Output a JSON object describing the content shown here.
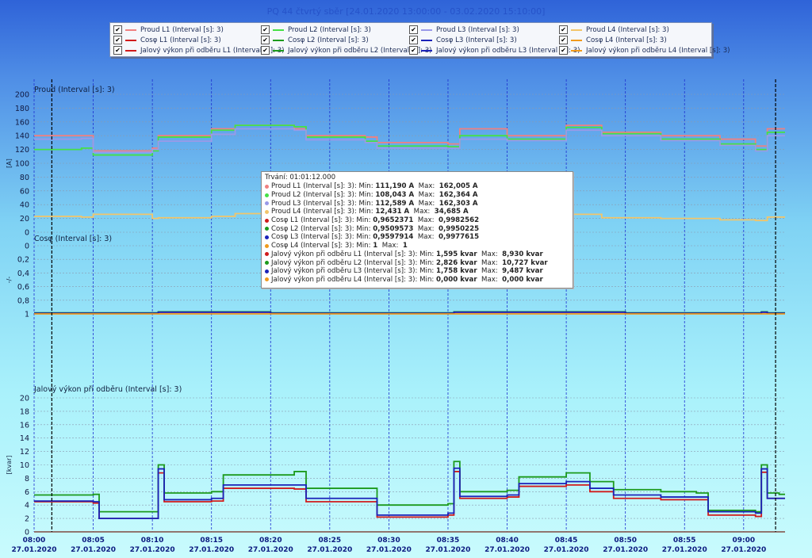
{
  "window_title": "PQ 44 čtvrtý sběr [24.01.2020 13:00:00 - 03.02.2020 15:10:00]",
  "legend": [
    {
      "label": "Proud L1 (Interval [s]: 3)",
      "color": "#f08080",
      "checked": "✔"
    },
    {
      "label": "Proud L2 (Interval [s]: 3)",
      "color": "#46e046",
      "checked": "✔"
    },
    {
      "label": "Proud L3 (Interval [s]: 3)",
      "color": "#9a9ae8",
      "checked": "✔"
    },
    {
      "label": "Proud L4 (Interval [s]: 3)",
      "color": "#f2c56a",
      "checked": "✔"
    },
    {
      "label": "Cosφ L1 (Interval [s]: 3)",
      "color": "#d11b1b",
      "checked": "✔"
    },
    {
      "label": "Cosφ L2 (Interval [s]: 3)",
      "color": "#1c9a1c",
      "checked": "✔"
    },
    {
      "label": "Cosφ L3 (Interval [s]: 3)",
      "color": "#1b22b8",
      "checked": "✔"
    },
    {
      "label": "Cosφ L4 (Interval [s]: 3)",
      "color": "#f09a1c",
      "checked": "✔"
    },
    {
      "label": "Jalový výkon při odběru L1 (Interval [s]: 3)",
      "color": "#d11b1b",
      "checked": "✔"
    },
    {
      "label": "Jalový výkon při odběru L2 (Interval [s]: 3)",
      "color": "#1c9a1c",
      "checked": "✔"
    },
    {
      "label": "Jalový výkon při odběru L3 (Interval [s]: 3)",
      "color": "#1b22b8",
      "checked": "✔"
    },
    {
      "label": "Jalový výkon při odběru L4 (Interval [s]: 3)",
      "color": "#f09a1c",
      "checked": "✔"
    }
  ],
  "tooltip": {
    "duration": "Trvání: 01:01:12.000",
    "rows": [
      {
        "name": "Proud L1 (Interval [s]: 3): Min:",
        "min": "111,190 A",
        "max_label": "Max:",
        "max": "162,005 A",
        "color": "#f08080"
      },
      {
        "name": "Proud L2 (Interval [s]: 3): Min:",
        "min": "108,043 A",
        "max_label": "Max:",
        "max": "162,364 A",
        "color": "#46e046"
      },
      {
        "name": "Proud L3 (Interval [s]: 3): Min:",
        "min": "112,589 A",
        "max_label": "Max:",
        "max": "162,303 A",
        "color": "#9a9ae8"
      },
      {
        "name": "Proud L4 (Interval [s]: 3): Min:",
        "min": "12,431 A",
        "max_label": "Max:",
        "max": "34,685 A",
        "color": "#f2c56a"
      },
      {
        "name": "Cosφ L1 (Interval [s]: 3): Min:",
        "min": "0,9652371",
        "max_label": "Max:",
        "max": "0,9982562",
        "color": "#d11b1b"
      },
      {
        "name": "Cosφ L2 (Interval [s]: 3): Min:",
        "min": "0,9509573",
        "max_label": "Max:",
        "max": "0,9950225",
        "color": "#1c9a1c"
      },
      {
        "name": "Cosφ L3 (Interval [s]: 3): Min:",
        "min": "0,9597914",
        "max_label": "Max:",
        "max": "0,9977615",
        "color": "#1b22b8"
      },
      {
        "name": "Cosφ L4 (Interval [s]: 3): Min:",
        "min": "1",
        "max_label": "Max:",
        "max": "1",
        "color": "#f09a1c"
      },
      {
        "name": "Jalový výkon při odběru L1 (Interval [s]: 3): Min:",
        "min": "1,595 kvar",
        "max_label": "Max:",
        "max": "8,930 kvar",
        "color": "#d11b1b"
      },
      {
        "name": "Jalový výkon při odběru L2 (Interval [s]: 3): Min:",
        "min": "2,826 kvar",
        "max_label": "Max:",
        "max": "10,727 kvar",
        "color": "#1c9a1c"
      },
      {
        "name": "Jalový výkon při odběru L3 (Interval [s]: 3): Min:",
        "min": "1,758 kvar",
        "max_label": "Max:",
        "max": "9,487 kvar",
        "color": "#1b22b8"
      },
      {
        "name": "Jalový výkon při odběru L4 (Interval [s]: 3): Min:",
        "min": "0,000 kvar",
        "max_label": "Max:",
        "max": "0,000 kvar",
        "color": "#f09a1c"
      }
    ]
  },
  "chart_data": [
    {
      "type": "line",
      "title": "Proud (Interval [s]: 3)",
      "ylabel": "[A]",
      "ylim": [
        0,
        200
      ],
      "yticks": [
        0,
        20,
        40,
        60,
        80,
        100,
        120,
        140,
        160,
        180,
        200
      ],
      "ytick_labels": [
        "0",
        "20",
        "40",
        "60",
        "80",
        "100",
        "120",
        "140",
        "160",
        "180",
        "200"
      ],
      "grid": true,
      "x_minutes": [
        0,
        4,
        5,
        10,
        10.5,
        15,
        17,
        22,
        23,
        28,
        29,
        35,
        36,
        40,
        45,
        48,
        53,
        58,
        61,
        62
      ],
      "series": [
        {
          "name": "Proud L1",
          "color": "#f08080",
          "values": [
            140,
            140,
            118,
            122,
            140,
            150,
            155,
            150,
            140,
            138,
            130,
            128,
            150,
            140,
            155,
            145,
            140,
            135,
            125,
            150
          ]
        },
        {
          "name": "Proud L2",
          "color": "#46e046",
          "values": [
            120,
            122,
            112,
            118,
            138,
            148,
            155,
            153,
            138,
            132,
            125,
            124,
            140,
            135,
            152,
            143,
            135,
            128,
            120,
            145
          ]
        },
        {
          "name": "Proud L3",
          "color": "#9a9ae8",
          "values": [
            135,
            136,
            116,
            120,
            132,
            142,
            150,
            148,
            134,
            130,
            122,
            122,
            135,
            133,
            148,
            140,
            133,
            126,
            118,
            140
          ]
        },
        {
          "name": "Proud L4",
          "color": "#f2c56a",
          "values": [
            23,
            22,
            26,
            20,
            21,
            23,
            27,
            25,
            22,
            24,
            23,
            20,
            25,
            23,
            26,
            21,
            20,
            18,
            17,
            22
          ]
        }
      ]
    },
    {
      "type": "line",
      "title": "Cosφ (Interval [s]: 3)",
      "ylabel": "-/-",
      "ylim": [
        0,
        1
      ],
      "yticks": [
        0,
        0.2,
        0.4,
        0.6,
        0.8,
        1
      ],
      "ytick_labels": [
        "0",
        "0,2",
        "0,4",
        "0,6",
        "0,8",
        "1"
      ],
      "y_inverted": true,
      "grid": true,
      "x_minutes": [
        0,
        10,
        10.5,
        20,
        35,
        35.5,
        50,
        61.5,
        62
      ],
      "series": [
        {
          "name": "Cosφ L1",
          "color": "#d11b1b",
          "values": [
            0.99,
            0.99,
            0.975,
            0.99,
            0.99,
            0.975,
            0.99,
            0.975,
            0.99
          ]
        },
        {
          "name": "Cosφ L2",
          "color": "#1c9a1c",
          "values": [
            0.985,
            0.985,
            0.97,
            0.985,
            0.985,
            0.97,
            0.985,
            0.97,
            0.985
          ]
        },
        {
          "name": "Cosφ L3",
          "color": "#1b22b8",
          "values": [
            0.99,
            0.99,
            0.975,
            0.99,
            0.99,
            0.975,
            0.99,
            0.975,
            0.99
          ]
        },
        {
          "name": "Cosφ L4",
          "color": "#f09a1c",
          "values": [
            1,
            1,
            1,
            1,
            1,
            1,
            1,
            1,
            1
          ]
        }
      ]
    },
    {
      "type": "line",
      "title": "Jalový výkon při odběru (Interval [s]: 3)",
      "ylabel": "[kvar]",
      "ylim": [
        0,
        20
      ],
      "yticks": [
        0,
        2,
        4,
        6,
        8,
        10,
        12,
        14,
        16,
        18,
        20
      ],
      "ytick_labels": [
        "0",
        "2",
        "4",
        "6",
        "8",
        "10",
        "12",
        "14",
        "16",
        "18",
        "20"
      ],
      "grid": true,
      "x_minutes": [
        0,
        5,
        5.5,
        10,
        10.5,
        11,
        15,
        16,
        22,
        23,
        28,
        29,
        35,
        35.5,
        36,
        40,
        41,
        45,
        47,
        49,
        53,
        56,
        57,
        61,
        61.5,
        62,
        63
      ],
      "series": [
        {
          "name": "Jalový výkon L1",
          "color": "#d11b1b",
          "values": [
            4.5,
            4.3,
            2.0,
            2.0,
            8.8,
            4.5,
            4.6,
            6.5,
            6.4,
            4.5,
            4.5,
            2.2,
            2.5,
            9.0,
            5.0,
            5.2,
            6.8,
            7.0,
            6.0,
            5.0,
            4.8,
            4.8,
            2.5,
            2.3,
            8.9,
            5.0,
            5.0
          ]
        },
        {
          "name": "Jalový výkon L2",
          "color": "#1c9a1c",
          "values": [
            5.5,
            5.6,
            3.0,
            3.0,
            10.0,
            5.8,
            6.0,
            8.5,
            9.0,
            6.5,
            6.5,
            4.0,
            4.2,
            10.5,
            6.0,
            6.2,
            8.2,
            8.8,
            7.5,
            6.3,
            6.0,
            5.8,
            3.2,
            3.0,
            10.0,
            5.8,
            5.6
          ]
        },
        {
          "name": "Jalový výkon L3",
          "color": "#1b22b8",
          "values": [
            4.6,
            4.5,
            2.0,
            2.0,
            9.4,
            4.8,
            5.0,
            7.0,
            7.0,
            5.0,
            5.0,
            2.5,
            2.8,
            9.5,
            5.3,
            5.5,
            7.2,
            7.5,
            6.5,
            5.5,
            5.2,
            5.2,
            3.0,
            2.8,
            9.4,
            5.0,
            5.0
          ]
        },
        {
          "name": "Jalový výkon L4",
          "color": "#f09a1c",
          "values": [
            0,
            0,
            0,
            0,
            0,
            0,
            0,
            0,
            0,
            0,
            0,
            0,
            0,
            0,
            0,
            0,
            0,
            0,
            0,
            0,
            0,
            0,
            0,
            0,
            0,
            0,
            0
          ]
        }
      ]
    }
  ],
  "x_axis": {
    "start_minute": 0,
    "end_minute": 63.5,
    "first_tick_label_minute": 0,
    "ticks": [
      {
        "minute": 0,
        "time": "08:00",
        "date": "27.01.2020"
      },
      {
        "minute": 5,
        "time": "08:05",
        "date": "27.01.2020"
      },
      {
        "minute": 10,
        "time": "08:10",
        "date": "27.01.2020"
      },
      {
        "minute": 15,
        "time": "08:15",
        "date": "27.01.2020"
      },
      {
        "minute": 20,
        "time": "08:20",
        "date": "27.01.2020"
      },
      {
        "minute": 25,
        "time": "08:25",
        "date": "27.01.2020"
      },
      {
        "minute": 30,
        "time": "08:30",
        "date": "27.01.2020"
      },
      {
        "minute": 35,
        "time": "08:35",
        "date": "27.01.2020"
      },
      {
        "minute": 40,
        "time": "08:40",
        "date": "27.01.2020"
      },
      {
        "minute": 45,
        "time": "08:45",
        "date": "27.01.2020"
      },
      {
        "minute": 50,
        "time": "08:50",
        "date": "27.01.2020"
      },
      {
        "minute": 55,
        "time": "08:55",
        "date": "27.01.2020"
      },
      {
        "minute": 60,
        "time": "09:00",
        "date": "27.01.2020"
      }
    ],
    "cursor_minutes": [
      1.5,
      62.7
    ]
  }
}
